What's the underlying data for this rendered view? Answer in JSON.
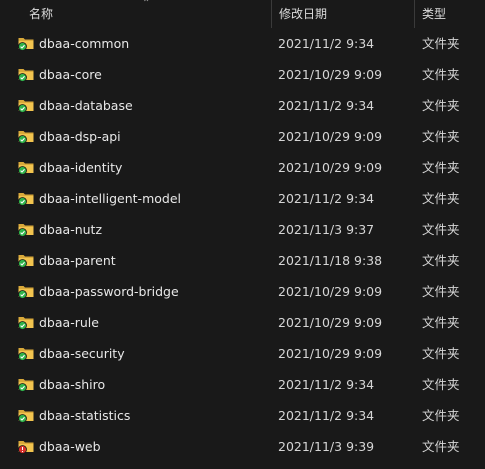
{
  "columns": {
    "name": "名称",
    "date": "修改日期",
    "type": "类型"
  },
  "colors": {
    "background": "#191919",
    "folder": "#f2c44f",
    "check": "#2fb34a",
    "error": "#d9302c"
  },
  "files": [
    {
      "name": "dbaa-common",
      "date": "2021/11/2 9:34",
      "type": "文件夹",
      "status": "check"
    },
    {
      "name": "dbaa-core",
      "date": "2021/10/29 9:09",
      "type": "文件夹",
      "status": "check"
    },
    {
      "name": "dbaa-database",
      "date": "2021/11/2 9:34",
      "type": "文件夹",
      "status": "check"
    },
    {
      "name": "dbaa-dsp-api",
      "date": "2021/10/29 9:09",
      "type": "文件夹",
      "status": "check"
    },
    {
      "name": "dbaa-identity",
      "date": "2021/10/29 9:09",
      "type": "文件夹",
      "status": "check"
    },
    {
      "name": "dbaa-intelligent-model",
      "date": "2021/11/2 9:34",
      "type": "文件夹",
      "status": "check"
    },
    {
      "name": "dbaa-nutz",
      "date": "2021/11/3 9:37",
      "type": "文件夹",
      "status": "check"
    },
    {
      "name": "dbaa-parent",
      "date": "2021/11/18 9:38",
      "type": "文件夹",
      "status": "check"
    },
    {
      "name": "dbaa-password-bridge",
      "date": "2021/10/29 9:09",
      "type": "文件夹",
      "status": "check"
    },
    {
      "name": "dbaa-rule",
      "date": "2021/10/29 9:09",
      "type": "文件夹",
      "status": "check"
    },
    {
      "name": "dbaa-security",
      "date": "2021/10/29 9:09",
      "type": "文件夹",
      "status": "check"
    },
    {
      "name": "dbaa-shiro",
      "date": "2021/11/2 9:34",
      "type": "文件夹",
      "status": "check"
    },
    {
      "name": "dbaa-statistics",
      "date": "2021/11/2 9:34",
      "type": "文件夹",
      "status": "check"
    },
    {
      "name": "dbaa-web",
      "date": "2021/11/3 9:39",
      "type": "文件夹",
      "status": "error"
    }
  ]
}
